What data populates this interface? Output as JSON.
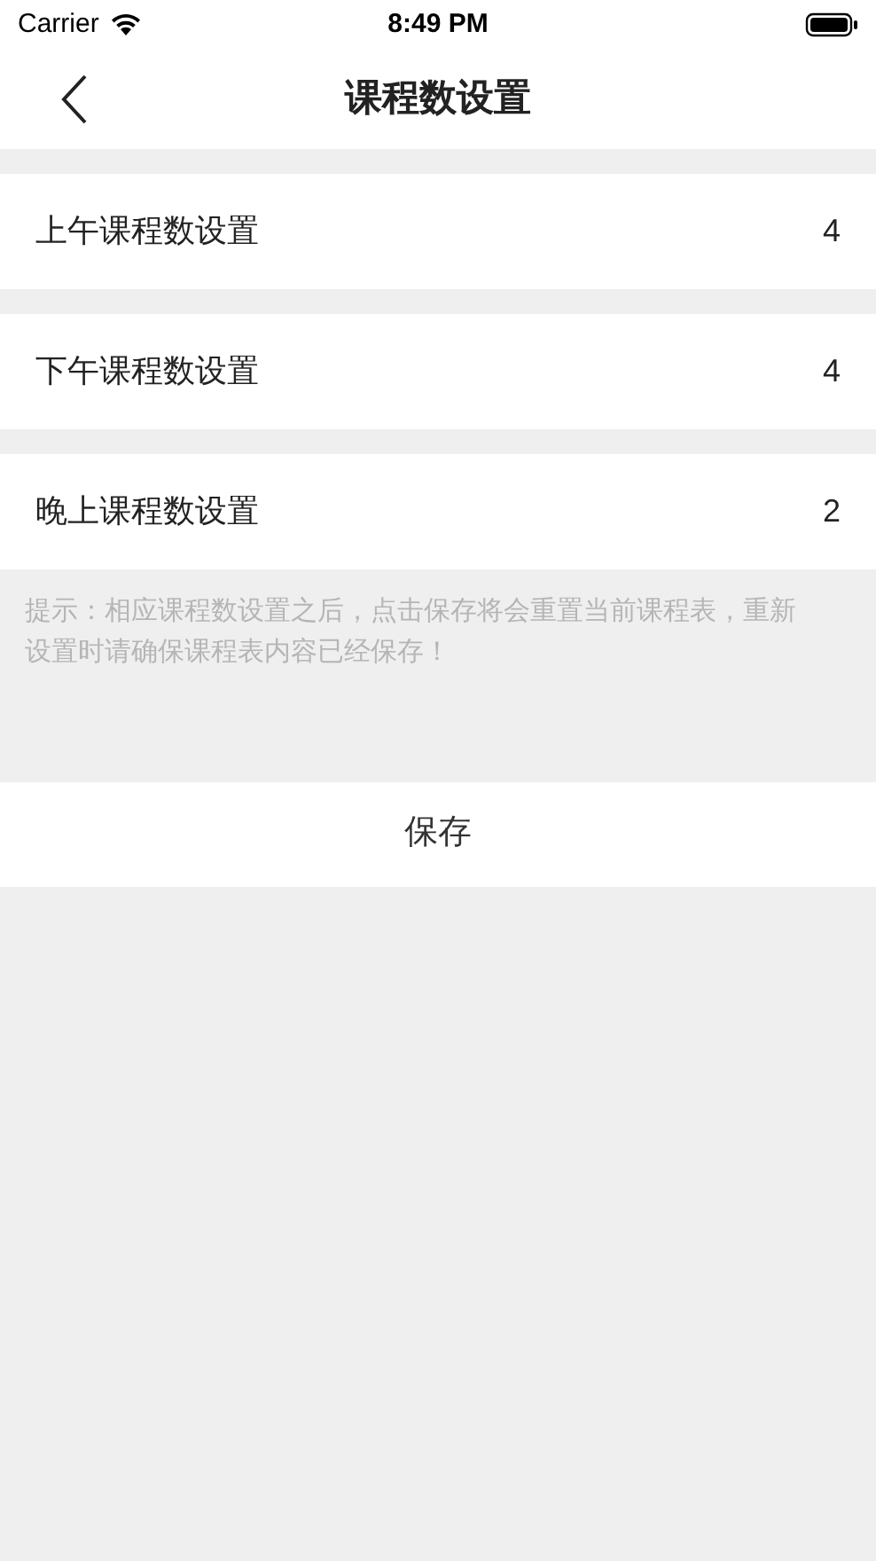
{
  "status_bar": {
    "carrier": "Carrier",
    "time": "8:49 PM"
  },
  "nav": {
    "title": "课程数设置"
  },
  "settings": [
    {
      "label": "上午课程数设置",
      "value": "4"
    },
    {
      "label": "下午课程数设置",
      "value": "4"
    },
    {
      "label": "晚上课程数设置",
      "value": "2"
    }
  ],
  "hint": "提示：相应课程数设置之后，点击保存将会重置当前课程表，重新设置时请确保课程表内容已经保存！",
  "save_button": "保存"
}
